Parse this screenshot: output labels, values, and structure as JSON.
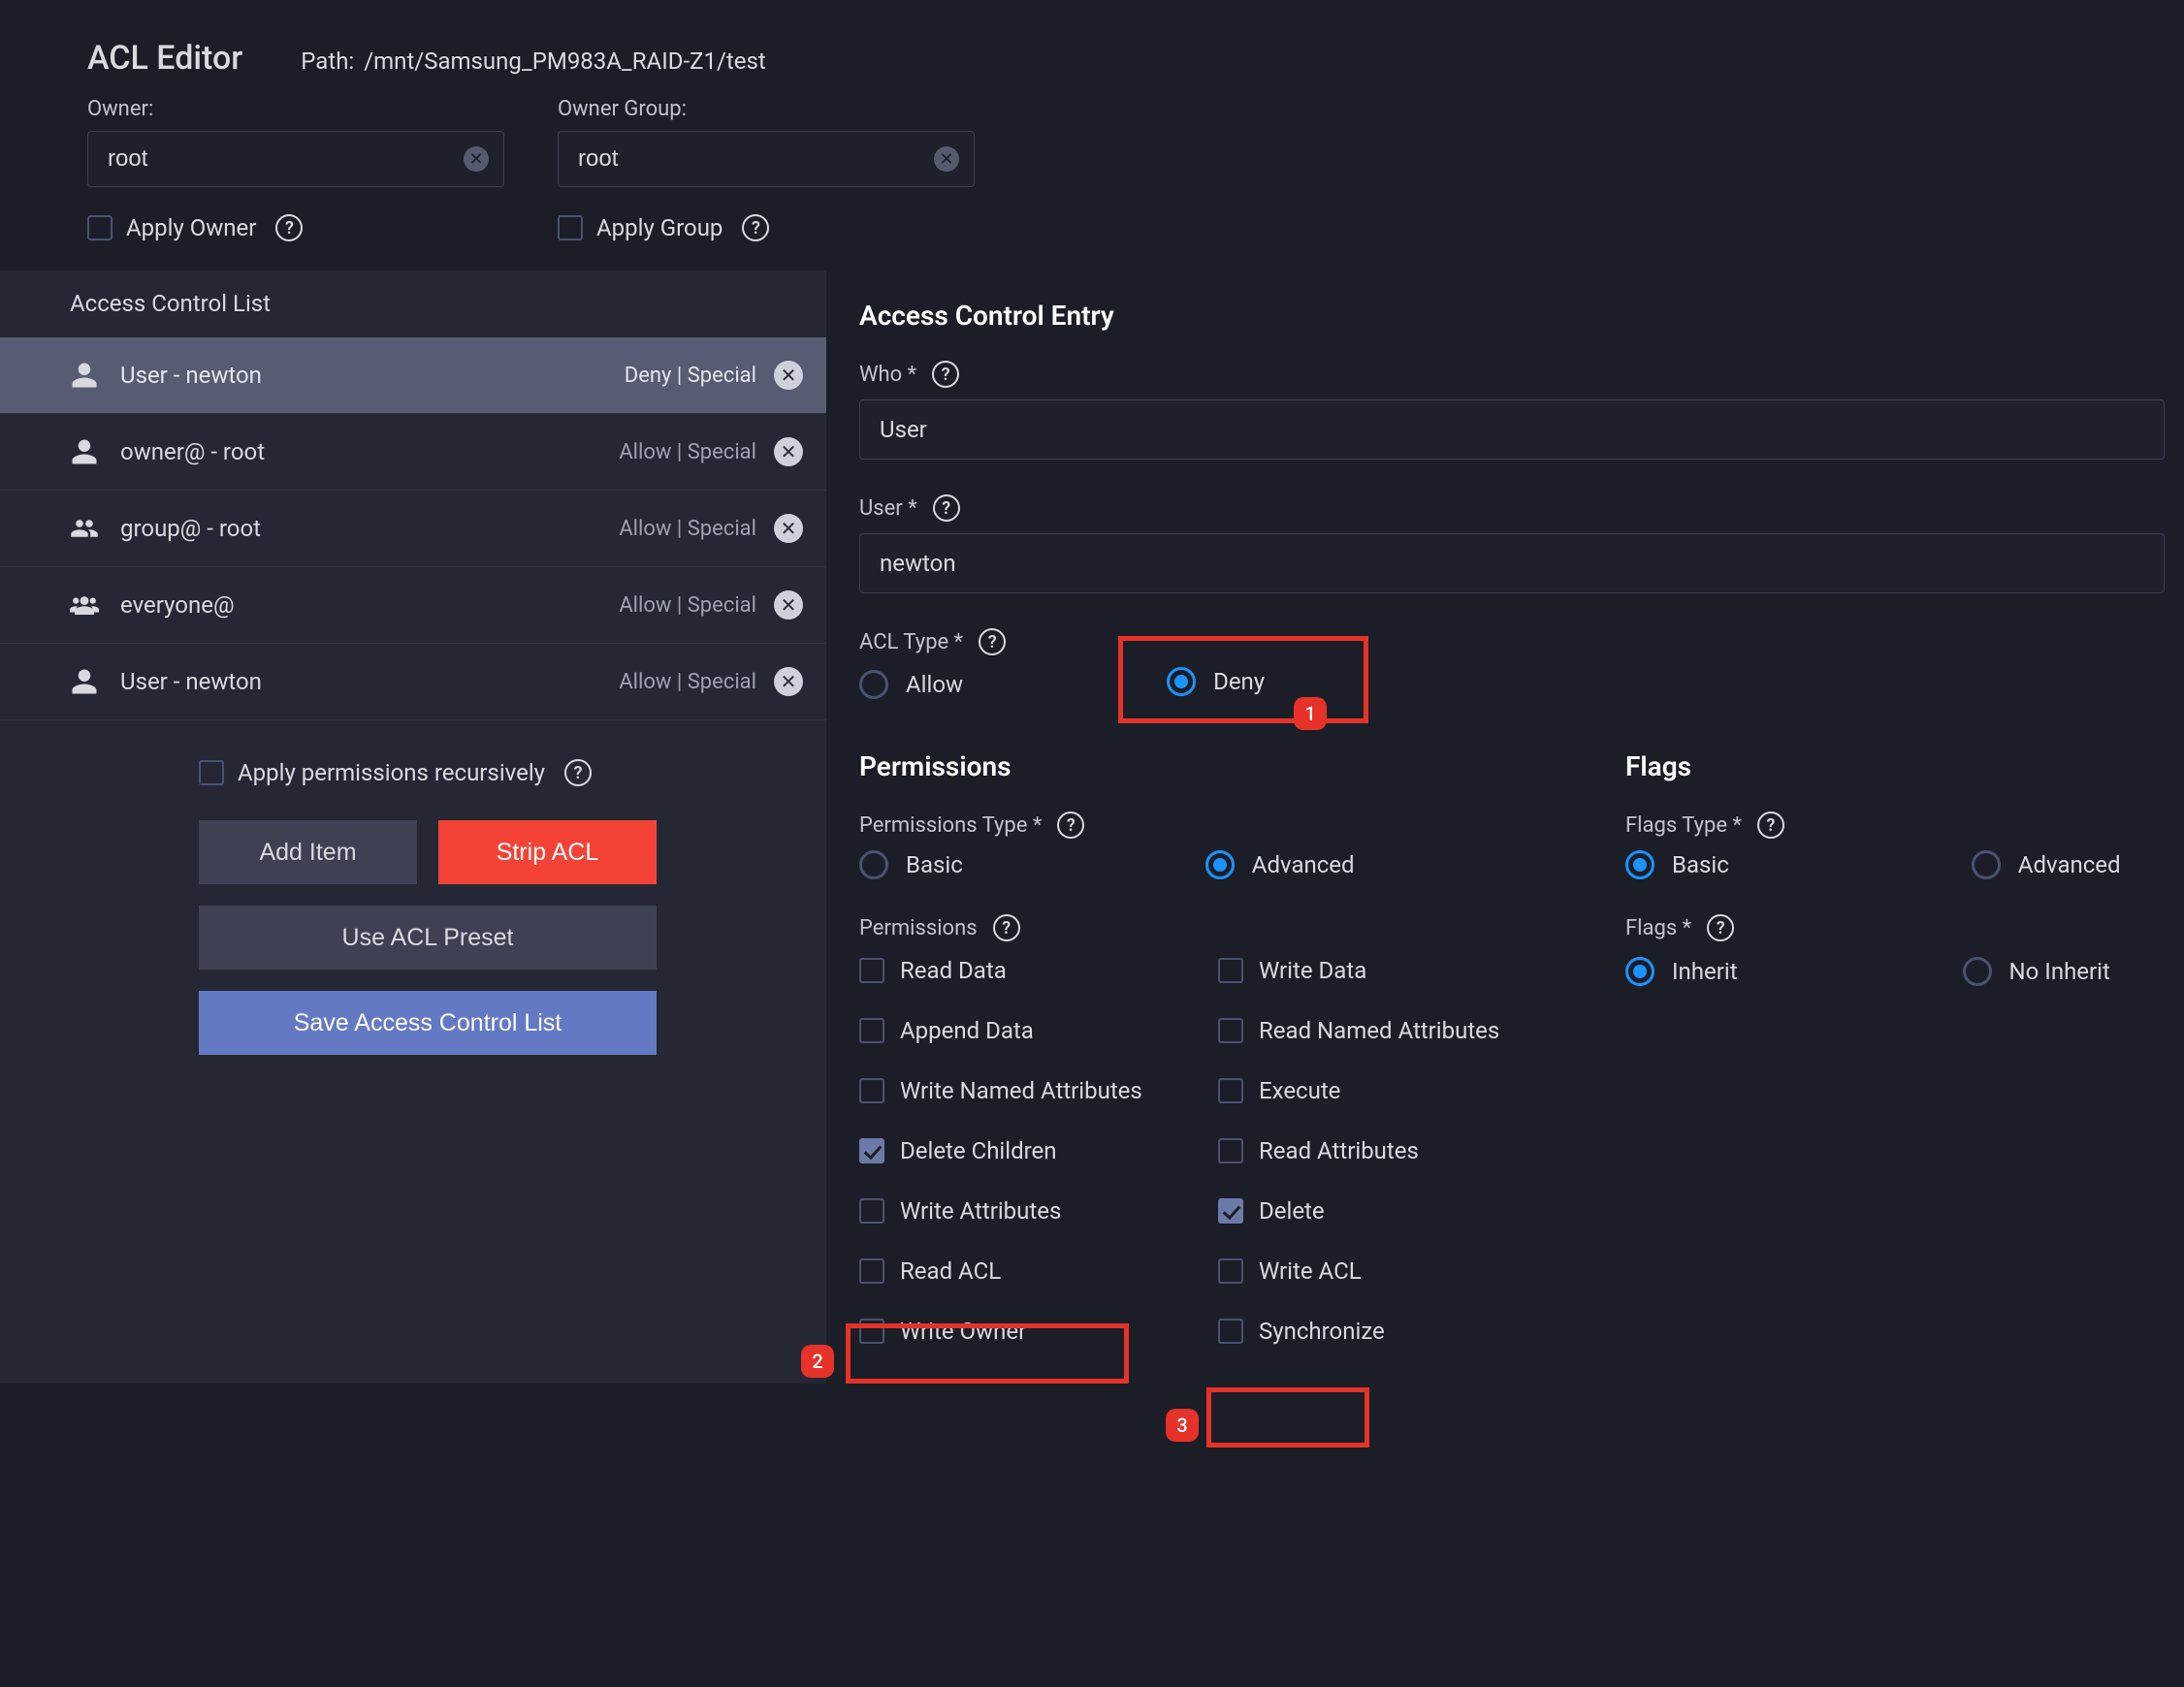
{
  "header": {
    "title": "ACL Editor",
    "path_label": "Path:",
    "path": "/mnt/Samsung_PM983A_RAID-Z1/test",
    "owner_label": "Owner:",
    "owner_value": "root",
    "owner_group_label": "Owner Group:",
    "owner_group_value": "root",
    "apply_owner": "Apply Owner",
    "apply_group": "Apply Group"
  },
  "acl": {
    "panel_title": "Access Control List",
    "items": [
      {
        "icon": "person",
        "label": "User - newton",
        "summary": "Deny | Special",
        "selected": true
      },
      {
        "icon": "person",
        "label": "owner@ - root",
        "summary": "Allow | Special",
        "selected": false
      },
      {
        "icon": "group",
        "label": "group@ - root",
        "summary": "Allow | Special",
        "selected": false
      },
      {
        "icon": "groups",
        "label": "everyone@",
        "summary": "Allow | Special",
        "selected": false
      },
      {
        "icon": "person",
        "label": "User - newton",
        "summary": "Allow | Special",
        "selected": false
      }
    ],
    "recursive": "Apply permissions recursively",
    "btn_add": "Add Item",
    "btn_strip": "Strip ACL",
    "btn_preset": "Use ACL Preset",
    "btn_save": "Save Access Control List"
  },
  "ace": {
    "title": "Access Control Entry",
    "who_label": "Who",
    "who_value": "User",
    "user_label": "User",
    "user_value": "newton",
    "acl_type_label": "ACL Type",
    "allow": "Allow",
    "deny": "Deny",
    "acl_type_selected": "deny"
  },
  "permissions": {
    "title": "Permissions",
    "type_label": "Permissions Type",
    "basic": "Basic",
    "advanced": "Advanced",
    "type_selected": "advanced",
    "list_label": "Permissions",
    "items": [
      {
        "key": "read_data",
        "label": "Read Data",
        "checked": false
      },
      {
        "key": "write_data",
        "label": "Write Data",
        "checked": false
      },
      {
        "key": "append_data",
        "label": "Append Data",
        "checked": false
      },
      {
        "key": "read_named_attr",
        "label": "Read Named Attributes",
        "checked": false
      },
      {
        "key": "write_named_attr",
        "label": "Write Named Attributes",
        "checked": false
      },
      {
        "key": "execute",
        "label": "Execute",
        "checked": false
      },
      {
        "key": "delete_children",
        "label": "Delete Children",
        "checked": true
      },
      {
        "key": "read_attributes",
        "label": "Read Attributes",
        "checked": false
      },
      {
        "key": "write_attributes",
        "label": "Write Attributes",
        "checked": false
      },
      {
        "key": "delete",
        "label": "Delete",
        "checked": true
      },
      {
        "key": "read_acl",
        "label": "Read ACL",
        "checked": false
      },
      {
        "key": "write_acl",
        "label": "Write ACL",
        "checked": false
      },
      {
        "key": "write_owner",
        "label": "Write Owner",
        "checked": false
      },
      {
        "key": "synchronize",
        "label": "Synchronize",
        "checked": false
      }
    ]
  },
  "flags": {
    "title": "Flags",
    "type_label": "Flags Type",
    "basic": "Basic",
    "advanced": "Advanced",
    "type_selected": "basic",
    "list_label": "Flags",
    "inherit": "Inherit",
    "no_inherit": "No Inherit",
    "selected": "inherit"
  },
  "annotations": {
    "a1": "1",
    "a2": "2",
    "a3": "3"
  }
}
